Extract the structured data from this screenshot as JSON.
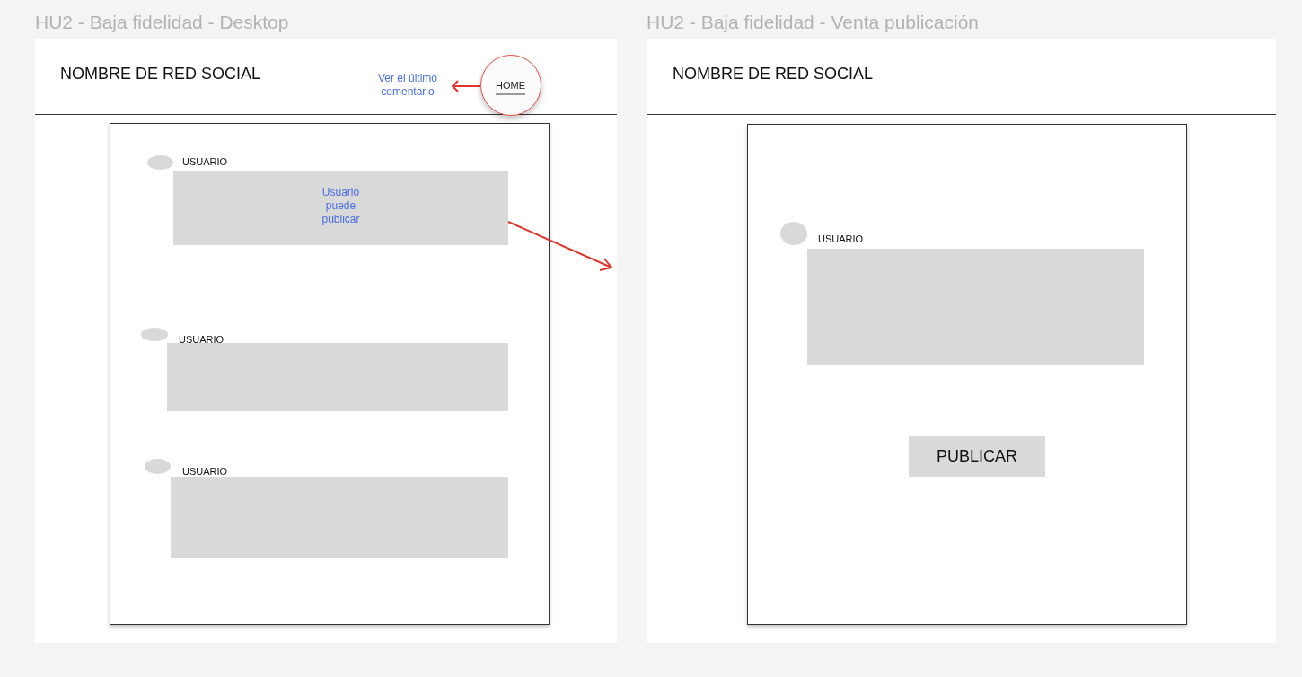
{
  "frames": [
    {
      "title": "HU2 - Baja fidelidad - Desktop",
      "kind": "feed",
      "header": {
        "brand": "NOMBRE DE RED SOCIAL",
        "annotation": "Ver el último comentario",
        "nav": "HOME"
      },
      "posts": [
        {
          "user": "USUARIO",
          "note": "Usuario puede publicar"
        },
        {
          "user": "USUARIO"
        },
        {
          "user": "USUARIO"
        }
      ]
    },
    {
      "title": "HU2 - Baja fidelidad - Venta publicación",
      "kind": "compose",
      "header": {
        "brand": "NOMBRE DE RED SOCIAL"
      },
      "posts": [
        {
          "user": "USUARIO"
        }
      ],
      "button": "PUBLICAR"
    }
  ]
}
